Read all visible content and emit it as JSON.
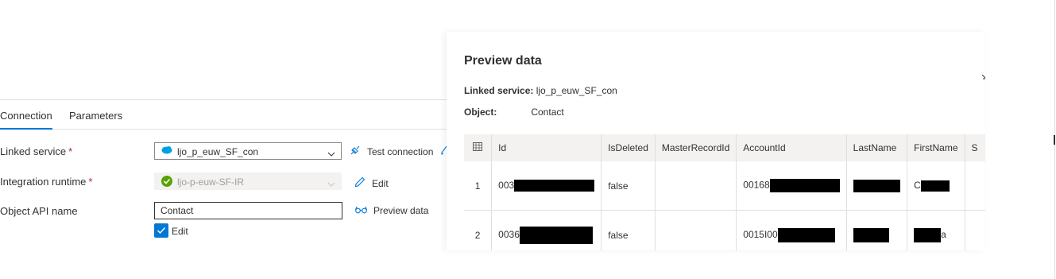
{
  "tabs": [
    {
      "label": "Connection",
      "active": true
    },
    {
      "label": "Parameters",
      "active": false
    }
  ],
  "form": {
    "linked_service": {
      "label": "Linked service",
      "required": "*",
      "value": "ljo_p_euw_SF_con",
      "icon": "salesforce-icon"
    },
    "integration_runtime": {
      "label": "Integration runtime",
      "required": "*",
      "value": "ljo-p-euw-SF-IR",
      "icon": "check-circle-icon"
    },
    "object_api": {
      "label": "Object API name",
      "value": "Contact"
    },
    "edit_checkbox": {
      "label": "Edit",
      "checked": true
    }
  },
  "actions": {
    "test_connection": "Test connection",
    "edit": "Edit",
    "preview_data": "Preview data"
  },
  "preview": {
    "title": "Preview data",
    "linked_service_label": "Linked service:",
    "linked_service_value": "ljo_p_euw_SF_con",
    "object_label": "Object:",
    "object_value": "Contact",
    "columns": [
      "Id",
      "IsDeleted",
      "MasterRecordId",
      "AccountId",
      "LastName",
      "FirstName",
      "S"
    ],
    "rows": [
      {
        "num": "1",
        "id": "003",
        "deleted": "false",
        "master": "",
        "account": "00168",
        "last": "",
        "first": "C"
      },
      {
        "num": "2",
        "id": "0036",
        "deleted": "false",
        "master": "",
        "account": "0015I00",
        "last": "",
        "first": "a"
      }
    ]
  },
  "colors": {
    "accent": "#0078d4",
    "required": "#a4262c",
    "success": "#107c10"
  }
}
